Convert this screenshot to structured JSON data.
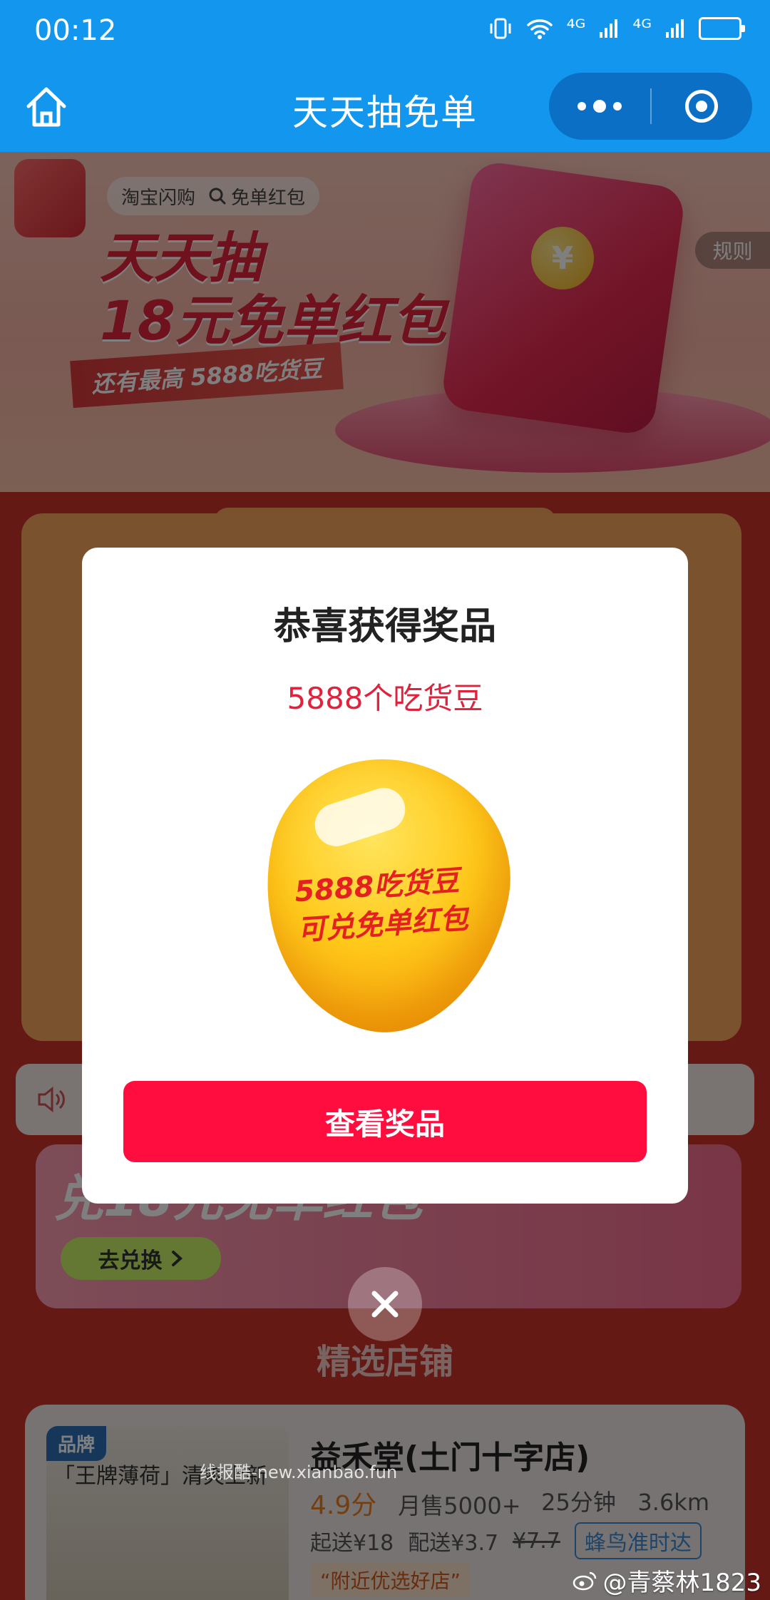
{
  "status_bar": {
    "time": "00:12",
    "network_1": "⁴ᴳ",
    "network_2": "⁴ᴳ"
  },
  "title_bar": {
    "title": "天天抽免单"
  },
  "banner": {
    "tag_1": "淘宝闪购",
    "tag_2": "免单红包",
    "headline_line1": "天天抽",
    "headline_line2": "18元免单红包",
    "subline": "还有最高 5888吃货豆",
    "rules_label": "规则"
  },
  "promo": {
    "title": "兑18元免单红包",
    "button_label": "去兑换"
  },
  "section_title": "精选店铺",
  "store": {
    "badge": "品牌",
    "slogan": "「王牌薄荷」清爽上新",
    "name": "益禾堂(土门十字店)",
    "rating": "4.9分",
    "monthly_sales": "月售5000+",
    "eta": "25分钟",
    "distance": "3.6km",
    "min_order": "起送¥18",
    "delivery_fee": "配送¥3.7",
    "original_fee": "¥7.7",
    "delivery_badge": "蜂鸟准时达",
    "tag": "“附近优选好店”"
  },
  "modal": {
    "title": "恭喜获得奖品",
    "prize": "5888个吃货豆",
    "bean_line1": "5888吃货豆",
    "bean_line2": "可兑免单红包",
    "cta_label": "查看奖品"
  },
  "watermark": "线报酷-new.xianbao.fun",
  "weibo_handle": "@青蔡林1823",
  "colors": {
    "brand_blue": "#1296ee",
    "cta_red": "#ff0d3e",
    "prize_red": "#e1223c"
  }
}
